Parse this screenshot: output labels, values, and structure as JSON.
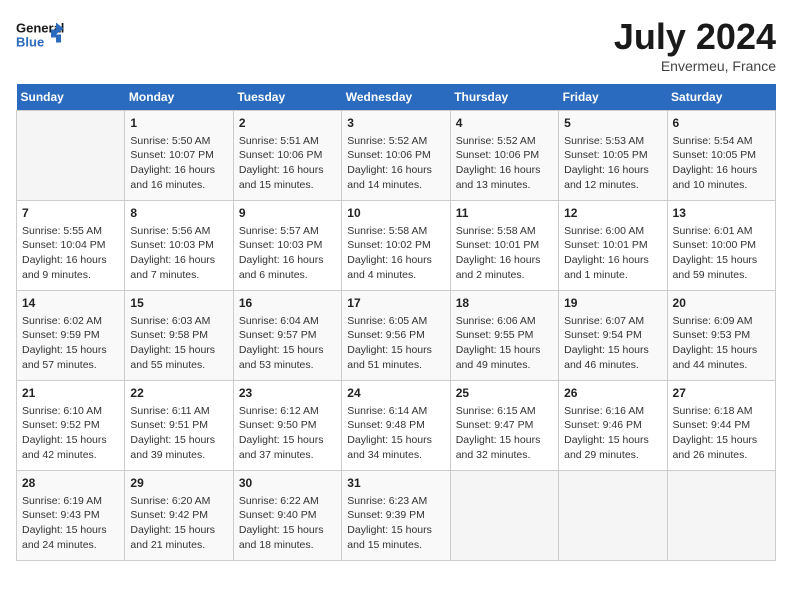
{
  "header": {
    "logo_line1": "General",
    "logo_line2": "Blue",
    "month_year": "July 2024",
    "location": "Envermeu, France"
  },
  "weekdays": [
    "Sunday",
    "Monday",
    "Tuesday",
    "Wednesday",
    "Thursday",
    "Friday",
    "Saturday"
  ],
  "weeks": [
    [
      {
        "day": "",
        "content": ""
      },
      {
        "day": "1",
        "content": "Sunrise: 5:50 AM\nSunset: 10:07 PM\nDaylight: 16 hours\nand 16 minutes."
      },
      {
        "day": "2",
        "content": "Sunrise: 5:51 AM\nSunset: 10:06 PM\nDaylight: 16 hours\nand 15 minutes."
      },
      {
        "day": "3",
        "content": "Sunrise: 5:52 AM\nSunset: 10:06 PM\nDaylight: 16 hours\nand 14 minutes."
      },
      {
        "day": "4",
        "content": "Sunrise: 5:52 AM\nSunset: 10:06 PM\nDaylight: 16 hours\nand 13 minutes."
      },
      {
        "day": "5",
        "content": "Sunrise: 5:53 AM\nSunset: 10:05 PM\nDaylight: 16 hours\nand 12 minutes."
      },
      {
        "day": "6",
        "content": "Sunrise: 5:54 AM\nSunset: 10:05 PM\nDaylight: 16 hours\nand 10 minutes."
      }
    ],
    [
      {
        "day": "7",
        "content": "Sunrise: 5:55 AM\nSunset: 10:04 PM\nDaylight: 16 hours\nand 9 minutes."
      },
      {
        "day": "8",
        "content": "Sunrise: 5:56 AM\nSunset: 10:03 PM\nDaylight: 16 hours\nand 7 minutes."
      },
      {
        "day": "9",
        "content": "Sunrise: 5:57 AM\nSunset: 10:03 PM\nDaylight: 16 hours\nand 6 minutes."
      },
      {
        "day": "10",
        "content": "Sunrise: 5:58 AM\nSunset: 10:02 PM\nDaylight: 16 hours\nand 4 minutes."
      },
      {
        "day": "11",
        "content": "Sunrise: 5:58 AM\nSunset: 10:01 PM\nDaylight: 16 hours\nand 2 minutes."
      },
      {
        "day": "12",
        "content": "Sunrise: 6:00 AM\nSunset: 10:01 PM\nDaylight: 16 hours\nand 1 minute."
      },
      {
        "day": "13",
        "content": "Sunrise: 6:01 AM\nSunset: 10:00 PM\nDaylight: 15 hours\nand 59 minutes."
      }
    ],
    [
      {
        "day": "14",
        "content": "Sunrise: 6:02 AM\nSunset: 9:59 PM\nDaylight: 15 hours\nand 57 minutes."
      },
      {
        "day": "15",
        "content": "Sunrise: 6:03 AM\nSunset: 9:58 PM\nDaylight: 15 hours\nand 55 minutes."
      },
      {
        "day": "16",
        "content": "Sunrise: 6:04 AM\nSunset: 9:57 PM\nDaylight: 15 hours\nand 53 minutes."
      },
      {
        "day": "17",
        "content": "Sunrise: 6:05 AM\nSunset: 9:56 PM\nDaylight: 15 hours\nand 51 minutes."
      },
      {
        "day": "18",
        "content": "Sunrise: 6:06 AM\nSunset: 9:55 PM\nDaylight: 15 hours\nand 49 minutes."
      },
      {
        "day": "19",
        "content": "Sunrise: 6:07 AM\nSunset: 9:54 PM\nDaylight: 15 hours\nand 46 minutes."
      },
      {
        "day": "20",
        "content": "Sunrise: 6:09 AM\nSunset: 9:53 PM\nDaylight: 15 hours\nand 44 minutes."
      }
    ],
    [
      {
        "day": "21",
        "content": "Sunrise: 6:10 AM\nSunset: 9:52 PM\nDaylight: 15 hours\nand 42 minutes."
      },
      {
        "day": "22",
        "content": "Sunrise: 6:11 AM\nSunset: 9:51 PM\nDaylight: 15 hours\nand 39 minutes."
      },
      {
        "day": "23",
        "content": "Sunrise: 6:12 AM\nSunset: 9:50 PM\nDaylight: 15 hours\nand 37 minutes."
      },
      {
        "day": "24",
        "content": "Sunrise: 6:14 AM\nSunset: 9:48 PM\nDaylight: 15 hours\nand 34 minutes."
      },
      {
        "day": "25",
        "content": "Sunrise: 6:15 AM\nSunset: 9:47 PM\nDaylight: 15 hours\nand 32 minutes."
      },
      {
        "day": "26",
        "content": "Sunrise: 6:16 AM\nSunset: 9:46 PM\nDaylight: 15 hours\nand 29 minutes."
      },
      {
        "day": "27",
        "content": "Sunrise: 6:18 AM\nSunset: 9:44 PM\nDaylight: 15 hours\nand 26 minutes."
      }
    ],
    [
      {
        "day": "28",
        "content": "Sunrise: 6:19 AM\nSunset: 9:43 PM\nDaylight: 15 hours\nand 24 minutes."
      },
      {
        "day": "29",
        "content": "Sunrise: 6:20 AM\nSunset: 9:42 PM\nDaylight: 15 hours\nand 21 minutes."
      },
      {
        "day": "30",
        "content": "Sunrise: 6:22 AM\nSunset: 9:40 PM\nDaylight: 15 hours\nand 18 minutes."
      },
      {
        "day": "31",
        "content": "Sunrise: 6:23 AM\nSunset: 9:39 PM\nDaylight: 15 hours\nand 15 minutes."
      },
      {
        "day": "",
        "content": ""
      },
      {
        "day": "",
        "content": ""
      },
      {
        "day": "",
        "content": ""
      }
    ]
  ]
}
